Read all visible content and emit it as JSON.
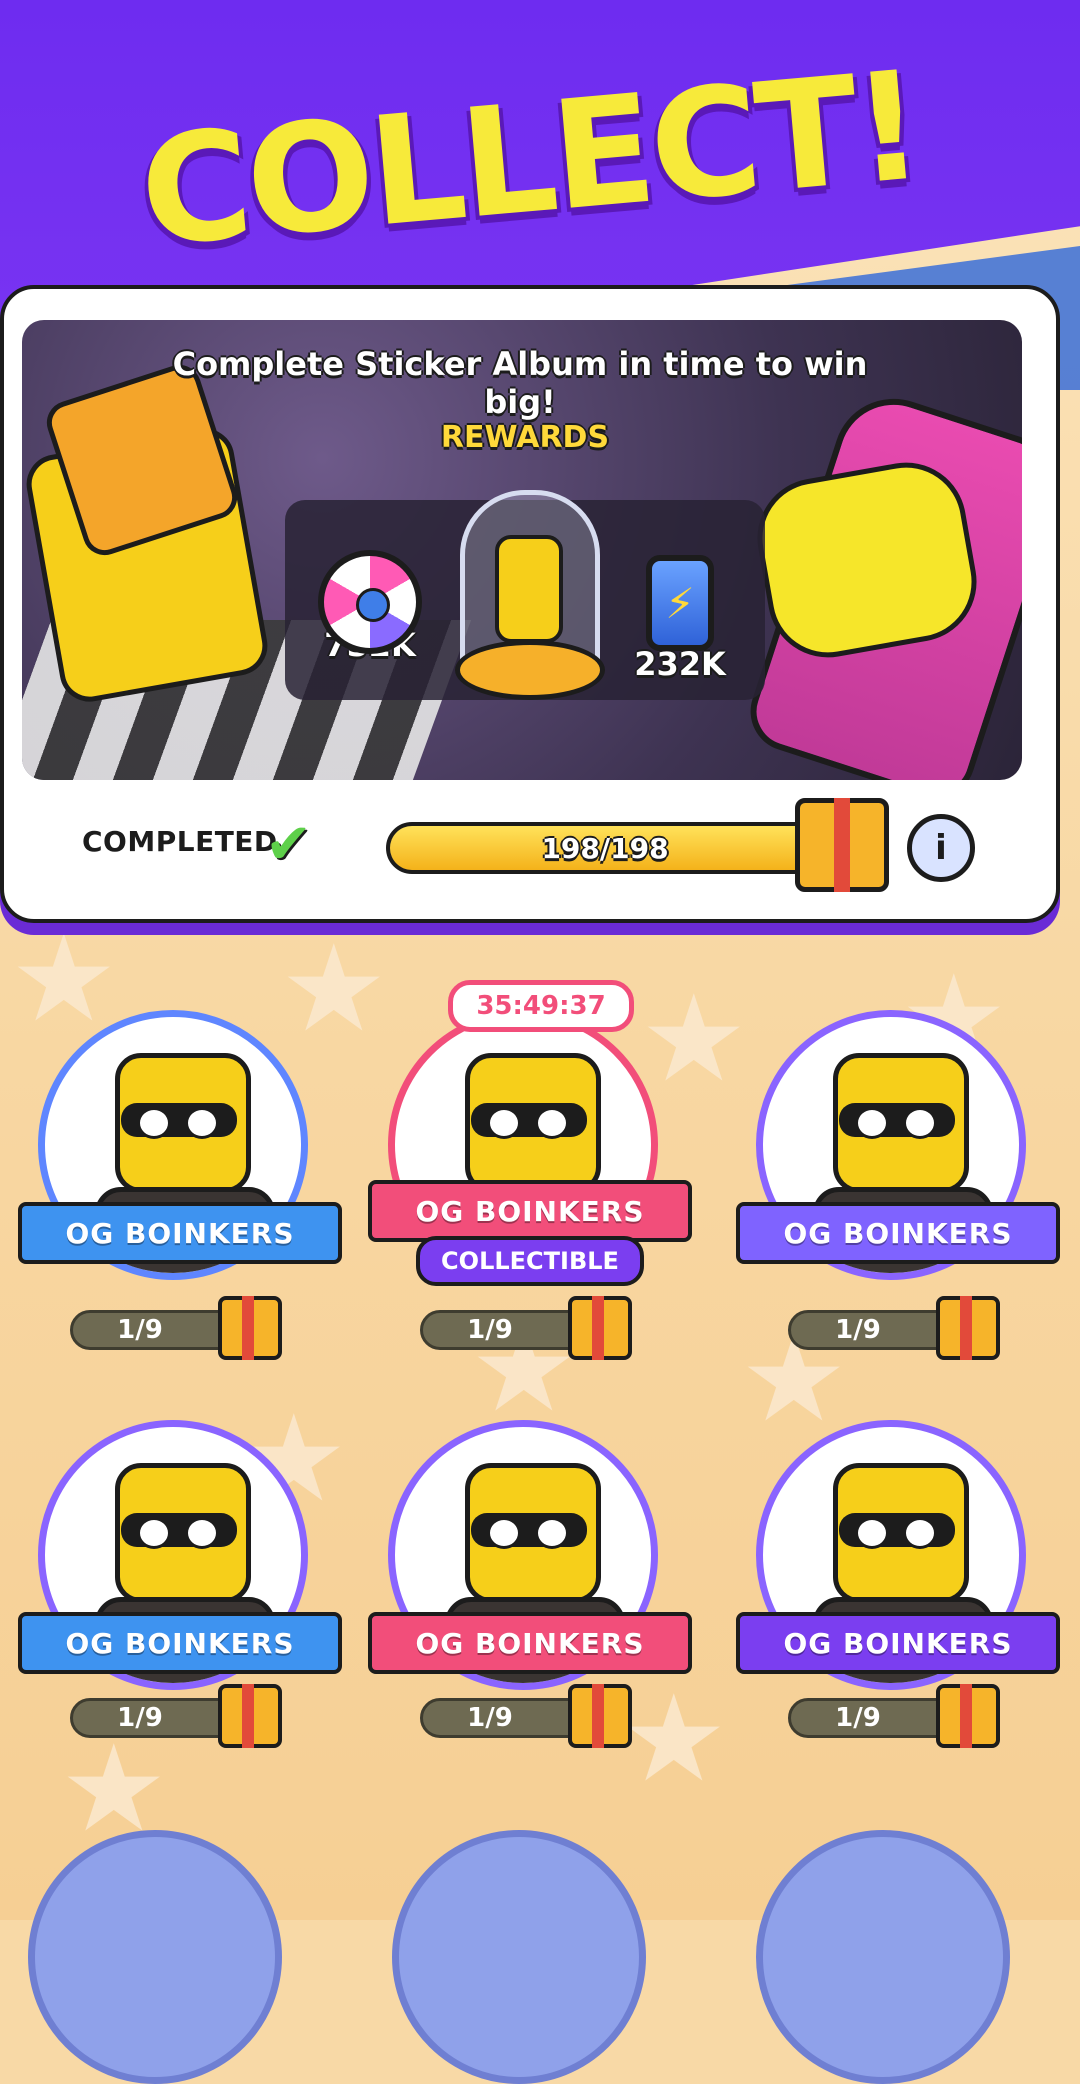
{
  "header": {
    "headline": "COLLECT!"
  },
  "album": {
    "tagline": "Complete Sticker Album in time to win big!",
    "rewards_label": "REWARDS",
    "rewards": [
      {
        "icon": "spin-wheel-icon",
        "value": "752K"
      },
      {
        "icon": "character-dome-icon",
        "value": ""
      },
      {
        "icon": "energy-battery-icon",
        "value": "232K"
      }
    ],
    "status": "COMPLETED",
    "progress": {
      "text": "198/198",
      "current": 198,
      "total": 198
    }
  },
  "stickers": [
    {
      "label": "OG BOINKERS",
      "count": "1/9",
      "color": "#3e93f0"
    },
    {
      "label": "OG BOINKERS",
      "count": "1/9",
      "color": "#f24e7a",
      "timer": "35:49:37",
      "tag": "COLLECTIBLE"
    },
    {
      "label": "OG BOINKERS",
      "count": "1/9",
      "color": "#7f63ff"
    },
    {
      "label": "OG BOINKERS",
      "count": "1/9",
      "color": "#3e93f0"
    },
    {
      "label": "OG BOINKERS",
      "count": "1/9",
      "color": "#f24e7a"
    },
    {
      "label": "OG BOINKERS",
      "count": "1/9",
      "color": "#7b3ef0"
    }
  ]
}
